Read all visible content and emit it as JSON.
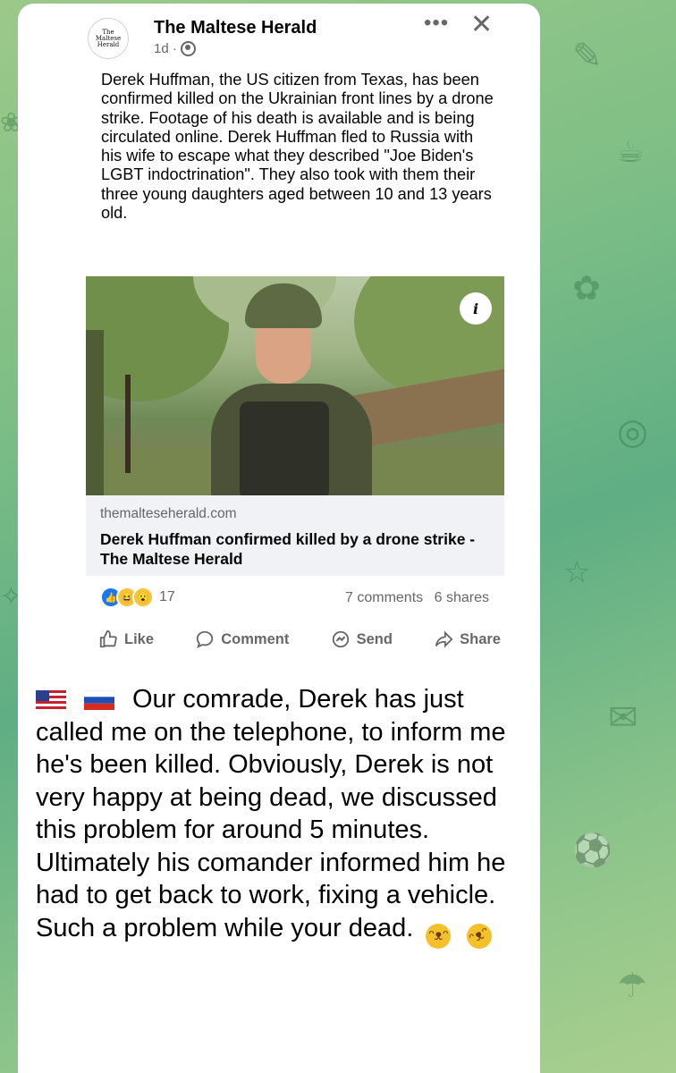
{
  "post": {
    "page_name": "The Maltese Herald",
    "logo_text": "The Maltese Herald",
    "time": "1d ·",
    "more": "•••",
    "close": "✕",
    "body": "Derek Huffman, the US citizen from Texas, has been confirmed killed on the Ukrainian front lines by a drone strike. Footage of his death is available and is being circulated online. Derek Huffman fled to Russia with his wife to escape what they described \"Joe Biden's LGBT indoctrination\". They also took with them their three young daughters aged between 10 and 13 years old.",
    "info_label": "i",
    "link": {
      "domain": "themalteseherald.com",
      "title": "Derek Huffman confirmed killed by a drone strike - The Maltese Herald"
    },
    "reaction_count": "17",
    "comments": "7 comments",
    "shares": "6 shares",
    "actions": {
      "like": "Like",
      "comment": "Comment",
      "send": "Send",
      "share": "Share"
    }
  },
  "message": {
    "text": "Our comrade, Derek has just called me on the telephone, to inform me he's been killed. Obviously, Derek is not very happy at being dead, we discussed this problem for around 5 minutes. Ultimately his comander informed him he had to get back to work, fixing a vehicle. Such a problem while your dead.",
    "flags": [
      "us-flag",
      "russia-flag"
    ],
    "trailing_emojis": [
      "laughing-emoji",
      "rolling-laughing-emoji"
    ]
  },
  "colors": {
    "facebook_blue": "#1877f2",
    "secondary_text": "#65676b",
    "link_bg": "#f0f2f5",
    "chat_background": "#6fb486"
  }
}
